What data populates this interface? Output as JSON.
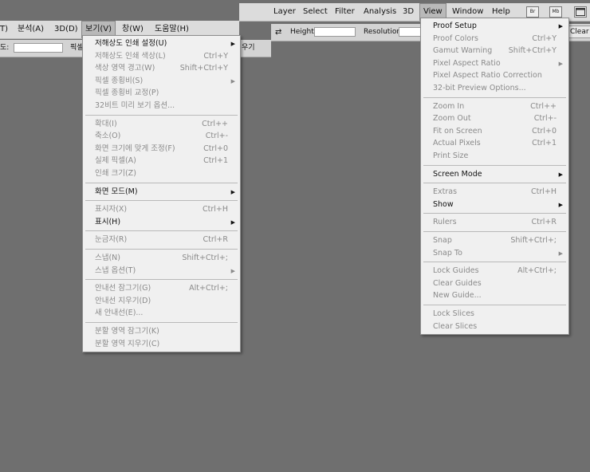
{
  "left_menubar": [
    "T)",
    "분석(A)",
    "3D(D)",
    "보기(V)",
    "창(W)",
    "도움말(H)"
  ],
  "right_menubar": [
    "Layer",
    "Select",
    "Filter",
    "Analysis",
    "3D",
    "View",
    "Window",
    "Help"
  ],
  "right_icons": [
    "Br",
    "Mb",
    "screen-mode-icon"
  ],
  "options_left": {
    "label": "도:",
    "partial_a": "픽셀",
    "partial_b": "우기"
  },
  "options_right": {
    "height_label": "Height:",
    "resolution_label": "Resolution:",
    "clear_label": "Clear"
  },
  "ko_menu": [
    {
      "label": "저해상도 인쇄 설정(U)",
      "shortcut": "",
      "arrow": true,
      "enabled": true
    },
    {
      "label": "저해상도 인쇄 색상(L)",
      "shortcut": "Ctrl+Y",
      "arrow": false,
      "enabled": false
    },
    {
      "label": "색상 영역 경고(W)",
      "shortcut": "Shift+Ctrl+Y",
      "arrow": false,
      "enabled": false
    },
    {
      "label": "픽셀 종횡비(S)",
      "shortcut": "",
      "arrow": true,
      "enabled": false
    },
    {
      "label": "픽셀 종횡비 교정(P)",
      "shortcut": "",
      "arrow": false,
      "enabled": false
    },
    {
      "label": "32비트 미리 보기 옵션...",
      "shortcut": "",
      "arrow": false,
      "enabled": false
    },
    {
      "sep": true
    },
    {
      "label": "확대(I)",
      "shortcut": "Ctrl++",
      "arrow": false,
      "enabled": false
    },
    {
      "label": "축소(O)",
      "shortcut": "Ctrl+-",
      "arrow": false,
      "enabled": false
    },
    {
      "label": "화면 크기에 맞게 조정(F)",
      "shortcut": "Ctrl+0",
      "arrow": false,
      "enabled": false
    },
    {
      "label": "실제 픽셀(A)",
      "shortcut": "Ctrl+1",
      "arrow": false,
      "enabled": false
    },
    {
      "label": "인쇄 크기(Z)",
      "shortcut": "",
      "arrow": false,
      "enabled": false
    },
    {
      "sep": true
    },
    {
      "label": "화면 모드(M)",
      "shortcut": "",
      "arrow": true,
      "enabled": true
    },
    {
      "sep": true
    },
    {
      "label": "표시자(X)",
      "shortcut": "Ctrl+H",
      "arrow": false,
      "enabled": false
    },
    {
      "label": "표시(H)",
      "shortcut": "",
      "arrow": true,
      "enabled": true
    },
    {
      "sep": true
    },
    {
      "label": "눈금자(R)",
      "shortcut": "Ctrl+R",
      "arrow": false,
      "enabled": false
    },
    {
      "sep": true
    },
    {
      "label": "스냅(N)",
      "shortcut": "Shift+Ctrl+;",
      "arrow": false,
      "enabled": false
    },
    {
      "label": "스냅 옵션(T)",
      "shortcut": "",
      "arrow": true,
      "enabled": false
    },
    {
      "sep": true
    },
    {
      "label": "안내선 잠그기(G)",
      "shortcut": "Alt+Ctrl+;",
      "arrow": false,
      "enabled": false
    },
    {
      "label": "안내선 지우기(D)",
      "shortcut": "",
      "arrow": false,
      "enabled": false
    },
    {
      "label": "새 안내선(E)...",
      "shortcut": "",
      "arrow": false,
      "enabled": false
    },
    {
      "sep": true
    },
    {
      "label": "분할 영역 잠그기(K)",
      "shortcut": "",
      "arrow": false,
      "enabled": false
    },
    {
      "label": "분할 영역 지우기(C)",
      "shortcut": "",
      "arrow": false,
      "enabled": false
    }
  ],
  "en_menu": [
    {
      "label": "Proof Setup",
      "shortcut": "",
      "arrow": true,
      "enabled": true
    },
    {
      "label": "Proof Colors",
      "shortcut": "Ctrl+Y",
      "arrow": false,
      "enabled": false
    },
    {
      "label": "Gamut Warning",
      "shortcut": "Shift+Ctrl+Y",
      "arrow": false,
      "enabled": false
    },
    {
      "label": "Pixel Aspect Ratio",
      "shortcut": "",
      "arrow": true,
      "enabled": false
    },
    {
      "label": "Pixel Aspect Ratio Correction",
      "shortcut": "",
      "arrow": false,
      "enabled": false
    },
    {
      "label": "32-bit Preview Options...",
      "shortcut": "",
      "arrow": false,
      "enabled": false
    },
    {
      "sep": true
    },
    {
      "label": "Zoom In",
      "shortcut": "Ctrl++",
      "arrow": false,
      "enabled": false
    },
    {
      "label": "Zoom Out",
      "shortcut": "Ctrl+-",
      "arrow": false,
      "enabled": false
    },
    {
      "label": "Fit on Screen",
      "shortcut": "Ctrl+0",
      "arrow": false,
      "enabled": false
    },
    {
      "label": "Actual Pixels",
      "shortcut": "Ctrl+1",
      "arrow": false,
      "enabled": false
    },
    {
      "label": "Print Size",
      "shortcut": "",
      "arrow": false,
      "enabled": false
    },
    {
      "sep": true
    },
    {
      "label": "Screen Mode",
      "shortcut": "",
      "arrow": true,
      "enabled": true
    },
    {
      "sep": true
    },
    {
      "label": "Extras",
      "shortcut": "Ctrl+H",
      "arrow": false,
      "enabled": false
    },
    {
      "label": "Show",
      "shortcut": "",
      "arrow": true,
      "enabled": true
    },
    {
      "sep": true
    },
    {
      "label": "Rulers",
      "shortcut": "Ctrl+R",
      "arrow": false,
      "enabled": false
    },
    {
      "sep": true
    },
    {
      "label": "Snap",
      "shortcut": "Shift+Ctrl+;",
      "arrow": false,
      "enabled": false
    },
    {
      "label": "Snap To",
      "shortcut": "",
      "arrow": true,
      "enabled": false
    },
    {
      "sep": true
    },
    {
      "label": "Lock Guides",
      "shortcut": "Alt+Ctrl+;",
      "arrow": false,
      "enabled": false
    },
    {
      "label": "Clear Guides",
      "shortcut": "",
      "arrow": false,
      "enabled": false
    },
    {
      "label": "New Guide...",
      "shortcut": "",
      "arrow": false,
      "enabled": false
    },
    {
      "sep": true
    },
    {
      "label": "Lock Slices",
      "shortcut": "",
      "arrow": false,
      "enabled": false
    },
    {
      "label": "Clear Slices",
      "shortcut": "",
      "arrow": false,
      "enabled": false
    }
  ]
}
